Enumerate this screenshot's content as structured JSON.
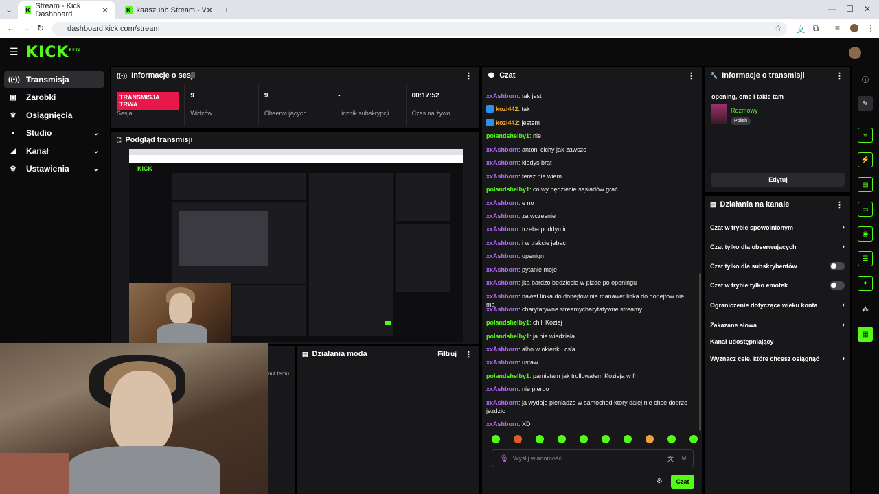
{
  "browser": {
    "tabs": [
      {
        "title": "Stream - Kick Dashboard",
        "active": true
      },
      {
        "title": "kaaszubb Stream - Watch Live",
        "active": false
      }
    ],
    "url": "dashboard.kick.com/stream"
  },
  "header": {
    "logo": "KICK",
    "logo_sup": "BETA"
  },
  "sidebar": {
    "items": [
      {
        "label": "Transmisja",
        "icon": "broadcast-icon",
        "active": true,
        "expandable": false
      },
      {
        "label": "Zarobki",
        "icon": "wallet-icon",
        "active": false,
        "expandable": false
      },
      {
        "label": "Osiągnięcia",
        "icon": "trophy-icon",
        "active": false,
        "expandable": false
      },
      {
        "label": "Studio",
        "icon": "studio-icon",
        "active": false,
        "expandable": true
      },
      {
        "label": "Kanał",
        "icon": "channel-icon",
        "active": false,
        "expandable": true
      },
      {
        "label": "Ustawienia",
        "icon": "gear-icon",
        "active": false,
        "expandable": true
      }
    ]
  },
  "session": {
    "title": "Informacje o sesji",
    "live_badge": "TRANSMISJA TRWA",
    "stats": [
      {
        "value": "",
        "label": "Sesja"
      },
      {
        "value": "9",
        "label": "Widzów"
      },
      {
        "value": "9",
        "label": "Obserwujących"
      },
      {
        "value": "-",
        "label": "Licznik subskrypcji"
      },
      {
        "value": "00:17:52",
        "label": "Czas na żywo"
      }
    ]
  },
  "preview": {
    "title": "Podgląd transmisji"
  },
  "mod_actions": {
    "title": "Działania moda",
    "filter_label": "Filtruj",
    "partial_text": "nut temu"
  },
  "chat": {
    "title": "Czat",
    "messages": [
      {
        "user": "xxAshborn",
        "color": "purple",
        "badge": false,
        "text": "tak jest"
      },
      {
        "user": "kozi442",
        "color": "orange",
        "badge": true,
        "text": "tak"
      },
      {
        "user": "kozi442",
        "color": "orange",
        "badge": true,
        "text": "jestem"
      },
      {
        "user": "polandshelby1",
        "color": "green",
        "badge": false,
        "text": "nie"
      },
      {
        "user": "xxAshborn",
        "color": "purple",
        "badge": false,
        "text": "antoni cichy jak zawsze"
      },
      {
        "user": "xxAshborn",
        "color": "purple",
        "badge": false,
        "text": "kiedys brat"
      },
      {
        "user": "xxAshborn",
        "color": "purple",
        "badge": false,
        "text": "teraz nie wiem"
      },
      {
        "user": "polandshelby1",
        "color": "green",
        "badge": false,
        "text": "co wy będziecie sąsiadów grać"
      },
      {
        "user": "xxAshborn",
        "color": "purple",
        "badge": false,
        "text": "e no"
      },
      {
        "user": "xxAshborn",
        "color": "purple",
        "badge": false,
        "text": "za wczesnie"
      },
      {
        "user": "xxAshborn",
        "color": "purple",
        "badge": false,
        "text": "trzeba poddymic"
      },
      {
        "user": "xxAshborn",
        "color": "purple",
        "badge": false,
        "text": "i w trakcie jebac"
      },
      {
        "user": "xxAshborn",
        "color": "purple",
        "badge": false,
        "text": "openign"
      },
      {
        "user": "xxAshborn",
        "color": "purple",
        "badge": false,
        "text": "pytanie moje"
      },
      {
        "user": "xxAshborn",
        "color": "purple",
        "badge": false,
        "text": "jka bardzo bedziecie w pizde po openingu"
      },
      {
        "user": "xxAshborn",
        "color": "purple",
        "badge": false,
        "text": "nawet linka do donejtow nie manawet linka do donejtow nie ma"
      },
      {
        "user": "xxAshborn",
        "color": "purple",
        "badge": false,
        "text": "charytatywne streamycharytatywne streamy"
      },
      {
        "user": "polandshelby1",
        "color": "green",
        "badge": false,
        "text": "chill Koziej"
      },
      {
        "user": "polandshelby1",
        "color": "green",
        "badge": false,
        "text": "ja nie wiedziala"
      },
      {
        "user": "xxAshborn",
        "color": "purple",
        "badge": false,
        "text": "albo w okienku cs'a"
      },
      {
        "user": "xxAshborn",
        "color": "purple",
        "badge": false,
        "text": "ustaw"
      },
      {
        "user": "polandshelby1",
        "color": "green",
        "badge": false,
        "text": "pamiątam jak trollowałem Kozieja w fn"
      },
      {
        "user": "xxAshborn",
        "color": "purple",
        "badge": false,
        "text": "nie pierdo"
      },
      {
        "user": "xxAshborn",
        "color": "purple",
        "badge": false,
        "text": "ja wydaje pieniadze w samochod ktory dalej nie chce dobrze jezdzic"
      },
      {
        "user": "xxAshborn",
        "color": "purple",
        "badge": false,
        "text": "XD"
      }
    ],
    "input_placeholder": "Wyślij wiadomość",
    "send_label": "Czat"
  },
  "stream_info": {
    "title": "Informacje o transmisji",
    "stream_title": "opening, ome i takie tam",
    "category": "Rozmowy",
    "language": "Polish",
    "edit_label": "Edytuj"
  },
  "channel_actions": {
    "title": "Działania na kanale",
    "items": [
      {
        "label": "Czat w trybie spowolnionym",
        "control": "chevron"
      },
      {
        "label": "Czat tylko dla obserwujących",
        "control": "chevron"
      },
      {
        "label": "Czat tylko dla subskrybentów",
        "control": "toggle",
        "on": false
      },
      {
        "label": "Czat w trybie tylko emotek",
        "control": "toggle",
        "on": false
      },
      {
        "label": "Ograniczenie dotyczące wieku konta",
        "control": "chevron"
      },
      {
        "label": "Zakazane słowa",
        "control": "chevron"
      },
      {
        "label": "Kanał udostępniający",
        "control": "none"
      },
      {
        "label": "Wyznacz cele, które chcesz osiągnąć",
        "control": "chevron"
      }
    ]
  },
  "colors": {
    "accent": "#53fc18",
    "live": "#e8184a",
    "purple": "#b86bff"
  }
}
